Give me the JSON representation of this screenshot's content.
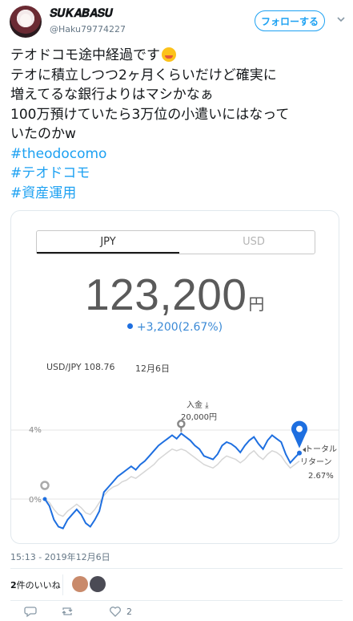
{
  "user": {
    "display_name": "𝑺𝑼𝑲𝑨𝑩𝑨𝑺𝑼",
    "handle": "@Haku79774227",
    "follow_label": "フォローする"
  },
  "tweet": {
    "lines": [
      "テオドコモ途中経過です",
      "テオに積立しつつ2ヶ月くらいだけど確実に",
      "増えてるな銀行よりはマシかなぁ",
      "100万預けていたら3万位の小遣いにはなって",
      "いたのかw"
    ],
    "hashtags": [
      "#theodocomo",
      "#テオドコモ",
      "#資産運用"
    ],
    "timestamp": "15:13 - 2019年12月6日",
    "likes_count": "2",
    "likes_label": "件のいいね"
  },
  "card": {
    "tab_jpy": "JPY",
    "tab_usd": "USD",
    "amount": "123,200",
    "amount_unit": "円",
    "change": "+3,200(2.67%)",
    "fx_rate": "USD/JPY 108.76",
    "date": "12月6日",
    "deposit_label": "入金",
    "deposit_amount": "20,000円",
    "total_return_label_1": "トータル",
    "total_return_label_2": "リターン",
    "total_return_value": "2.67%"
  },
  "chart_data": {
    "type": "line",
    "title": "",
    "xlabel": "",
    "ylabel": "",
    "y_ticks": [
      "0%",
      "4%"
    ],
    "ylim": [
      -2,
      5
    ],
    "series": [
      {
        "name": "",
        "color": "#1e6fe0",
        "values": [
          0.0,
          -0.4,
          -1.2,
          -1.6,
          -1.7,
          -1.2,
          -0.9,
          -0.6,
          -0.9,
          -1.4,
          -1.6,
          -1.2,
          -0.7,
          0.4,
          0.7,
          1.0,
          1.3,
          1.5,
          1.7,
          1.9,
          1.7,
          2.0,
          2.2,
          2.5,
          2.8,
          3.1,
          3.3,
          3.5,
          3.7,
          3.5,
          3.8,
          3.6,
          3.4,
          3.1,
          2.9,
          2.5,
          2.4,
          2.3,
          2.6,
          3.1,
          3.3,
          3.2,
          3.0,
          2.7,
          3.1,
          3.4,
          3.6,
          3.2,
          2.9,
          3.4,
          3.7,
          3.5,
          3.3,
          2.6,
          2.1,
          2.4,
          2.67
        ]
      },
      {
        "name": "",
        "color": "#d6d6d6",
        "values": [
          0.0,
          -0.2,
          -0.6,
          -0.9,
          -1.0,
          -0.7,
          -0.5,
          -0.3,
          -0.5,
          -0.8,
          -0.9,
          -0.6,
          -0.2,
          0.2,
          0.5,
          0.7,
          0.8,
          1.0,
          1.1,
          1.3,
          1.2,
          1.4,
          1.6,
          1.8,
          2.0,
          2.3,
          2.5,
          2.7,
          2.9,
          2.8,
          2.9,
          2.8,
          2.6,
          2.4,
          2.2,
          2.0,
          1.9,
          1.8,
          2.0,
          2.3,
          2.5,
          2.4,
          2.3,
          2.1,
          2.3,
          2.6,
          2.8,
          2.5,
          2.3,
          2.6,
          2.8,
          2.7,
          2.5,
          2.1,
          1.8,
          2.0,
          2.2
        ]
      }
    ],
    "markers": [
      {
        "label": "入金",
        "index": 30
      },
      {
        "label": "トータルリターン",
        "index": 56
      }
    ],
    "grid": true,
    "legend": "none"
  }
}
